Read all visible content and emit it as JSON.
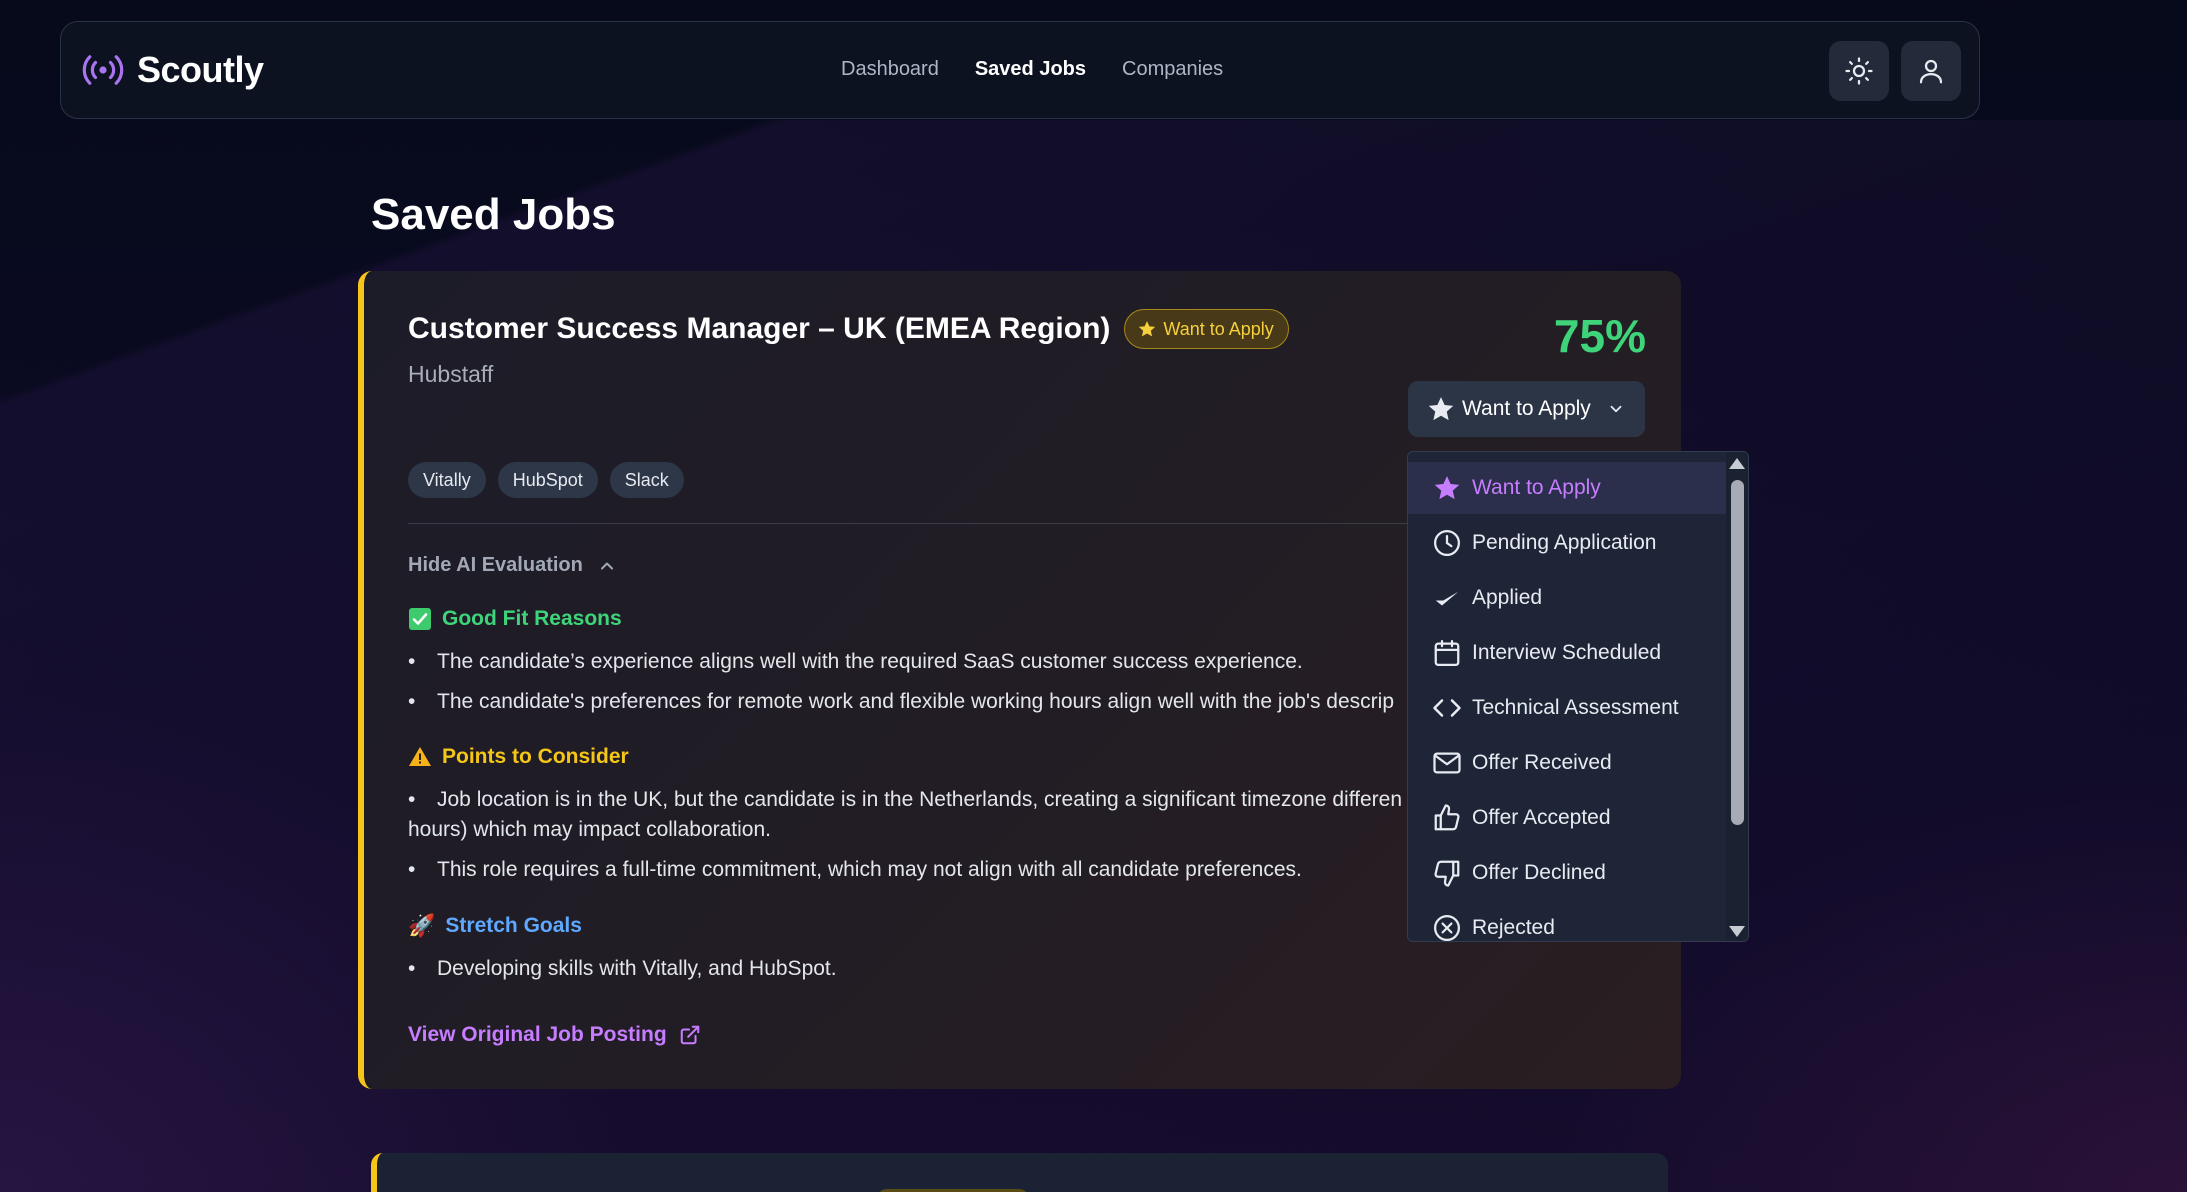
{
  "app": {
    "name": "Scoutly"
  },
  "nav": {
    "links": [
      "Dashboard",
      "Saved Jobs",
      "Companies"
    ],
    "active": "Saved Jobs",
    "icons": [
      "sun-icon",
      "user-icon"
    ]
  },
  "page": {
    "title": "Saved Jobs"
  },
  "job": {
    "title": "Customer Success Manager – UK (EMEA Region)",
    "status_pill": "Want to Apply",
    "company": "Hubstaff",
    "score": "75%",
    "status_select": "Want to Apply",
    "tags": [
      "Vitally",
      "HubSpot",
      "Slack"
    ],
    "eval_toggle": "Hide AI Evaluation",
    "good_fit": {
      "heading": "Good Fit Reasons",
      "items": [
        "The candidate’s experience aligns well with the required SaaS customer success experience.",
        "The candidate's preferences for remote work and flexible working hours align well with the job's descrip"
      ]
    },
    "consider": {
      "heading": "Points to Consider",
      "items": [
        "Job location is in the UK, but the candidate is in the Netherlands, creating a significant timezone differen hours) which may impact collaboration.",
        "This role requires a full-time commitment, which may not align with all candidate preferences."
      ]
    },
    "stretch": {
      "heading": "Stretch Goals",
      "items": [
        "Developing skills with Vitally, and HubSpot."
      ]
    },
    "view_link": "View Original Job Posting"
  },
  "dropdown": {
    "options": [
      {
        "label": "Want to Apply",
        "icon": "star-icon",
        "selected": true
      },
      {
        "label": "Pending Application",
        "icon": "clock-icon"
      },
      {
        "label": "Applied",
        "icon": "check-icon"
      },
      {
        "label": "Interview Scheduled",
        "icon": "calendar-icon"
      },
      {
        "label": "Technical Assessment",
        "icon": "code-icon"
      },
      {
        "label": "Offer Received",
        "icon": "mail-icon"
      },
      {
        "label": "Offer Accepted",
        "icon": "thumbs-up-icon"
      },
      {
        "label": "Offer Declined",
        "icon": "thumbs-down-icon"
      },
      {
        "label": "Rejected",
        "icon": "x-circle-icon"
      }
    ]
  },
  "colors": {
    "accent_yellow": "#f5c518",
    "score_green": "#3ed47a",
    "link_purple": "#c77dff",
    "stretch_blue": "#5fa8ff"
  }
}
